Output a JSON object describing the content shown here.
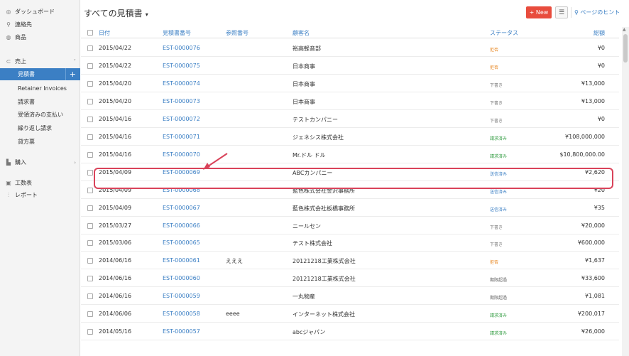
{
  "sidebar": {
    "items": [
      {
        "label": "ダッシュボード",
        "icon": "dashboard-icon",
        "glyph": "◎"
      },
      {
        "label": "連絡先",
        "icon": "contacts-icon",
        "glyph": "⚲"
      },
      {
        "label": "商品",
        "icon": "items-icon",
        "glyph": "◍"
      },
      {
        "label": "売上",
        "icon": "sales-icon",
        "glyph": "⊂"
      },
      {
        "label": "見積書",
        "active": true
      },
      {
        "label": "Retainer Invoices"
      },
      {
        "label": "請求書"
      },
      {
        "label": "受領済みの支払い"
      },
      {
        "label": "繰り返し請求"
      },
      {
        "label": "貸方票"
      },
      {
        "label": "購入",
        "icon": "purchases-icon",
        "glyph": "▙"
      },
      {
        "label": "工数表",
        "icon": "timesheet-icon",
        "glyph": "▣"
      },
      {
        "label": "レポート",
        "icon": "reports-icon",
        "glyph": "⫶"
      }
    ]
  },
  "header": {
    "title": "すべての見積書",
    "new_label": "+ New",
    "hint_label": "ページのヒント"
  },
  "table": {
    "columns": [
      "日付",
      "見積書番号",
      "参照番号",
      "顧客名",
      "ステータス",
      "総額"
    ],
    "rows": [
      {
        "date": "2015/04/22",
        "number": "EST-0000076",
        "ref": "",
        "customer": "裕高軽音部",
        "status": "拒否",
        "total": "¥0"
      },
      {
        "date": "2015/04/22",
        "number": "EST-0000075",
        "ref": "",
        "customer": "日本商事",
        "status": "拒否",
        "total": "¥0"
      },
      {
        "date": "2015/04/20",
        "number": "EST-0000074",
        "ref": "",
        "customer": "日本商事",
        "status": "下書き",
        "total": "¥13,000"
      },
      {
        "date": "2015/04/20",
        "number": "EST-0000073",
        "ref": "",
        "customer": "日本商事",
        "status": "下書き",
        "total": "¥13,000"
      },
      {
        "date": "2015/04/16",
        "number": "EST-0000072",
        "ref": "",
        "customer": "テストカンパニー",
        "status": "下書き",
        "total": "¥0"
      },
      {
        "date": "2015/04/16",
        "number": "EST-0000071",
        "ref": "",
        "customer": "ジェネシス株式会社",
        "status": "請求済み",
        "total": "¥108,000,000"
      },
      {
        "date": "2015/04/16",
        "number": "EST-0000070",
        "ref": "",
        "customer": "Mr.ドル ドル",
        "status": "請求済み",
        "total": "$10,800,000.00"
      },
      {
        "date": "2015/04/09",
        "number": "EST-0000069",
        "ref": "",
        "customer": "ABCカンパニー",
        "status": "送信済み",
        "total": "¥2,620"
      },
      {
        "date": "2015/04/09",
        "number": "EST-0000068",
        "ref": "",
        "customer": "藍色株式会社金沢事務所",
        "status": "送信済み",
        "total": "¥20"
      },
      {
        "date": "2015/04/09",
        "number": "EST-0000067",
        "ref": "",
        "customer": "藍色株式会社板橋事務所",
        "status": "送信済み",
        "total": "¥35"
      },
      {
        "date": "2015/03/27",
        "number": "EST-0000066",
        "ref": "",
        "customer": "ニールセン",
        "status": "下書き",
        "total": "¥20,000"
      },
      {
        "date": "2015/03/06",
        "number": "EST-0000065",
        "ref": "",
        "customer": "テスト株式会社",
        "status": "下書き",
        "total": "¥600,000"
      },
      {
        "date": "2014/06/16",
        "number": "EST-0000061",
        "ref": "えええ",
        "customer": "20121218工業株式会社",
        "status": "拒否",
        "total": "¥1,637"
      },
      {
        "date": "2014/06/16",
        "number": "EST-0000060",
        "ref": "",
        "customer": "20121218工業株式会社",
        "status": "期限超過",
        "total": "¥33,600"
      },
      {
        "date": "2014/06/16",
        "number": "EST-0000059",
        "ref": "",
        "customer": "一丸物産",
        "status": "期限超過",
        "total": "¥1,081"
      },
      {
        "date": "2014/06/06",
        "number": "EST-0000058",
        "ref": "eeee",
        "customer": "インターネット株式会社",
        "status": "請求済み",
        "total": "¥200,017"
      },
      {
        "date": "2014/05/16",
        "number": "EST-0000057",
        "ref": "",
        "customer": "abcジャパン",
        "status": "請求済み",
        "total": "¥26,000"
      }
    ]
  },
  "status_colors": {
    "拒否": "#e8861f",
    "下書き": "#777777",
    "請求済み": "#2e9a3e",
    "送信済み": "#3b7fc4",
    "期限超過": "#666666"
  },
  "colors": {
    "accent": "#3b7fc4",
    "new_button": "#e84c3d",
    "highlight": "#d9435a"
  }
}
